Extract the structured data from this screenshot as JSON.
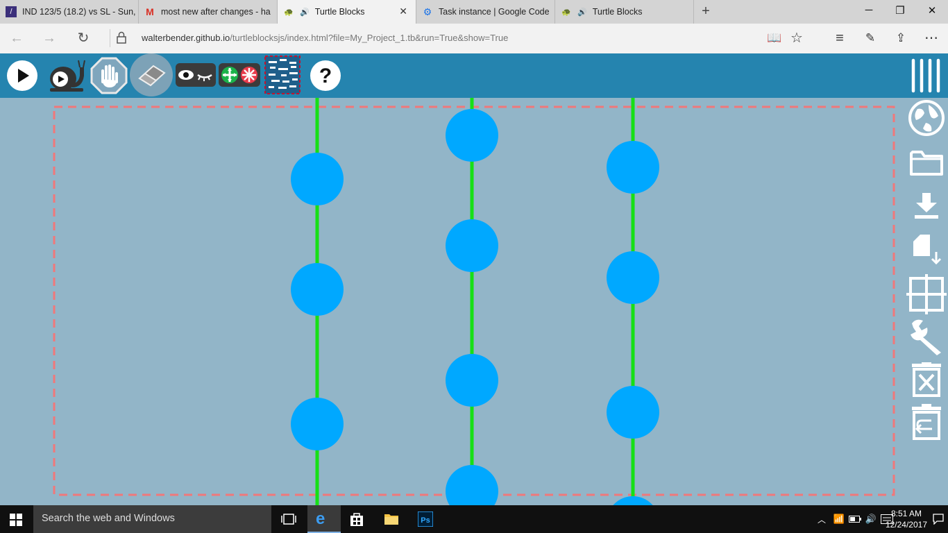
{
  "browser": {
    "tabs": [
      {
        "title": "IND 123/5 (18.2) vs SL - Sun,",
        "icon": "cricket-favicon",
        "active": false
      },
      {
        "title": "most new after changes - ha",
        "icon": "gmail-favicon",
        "active": false
      },
      {
        "title": "Turtle Blocks",
        "icon": "turtle-favicon",
        "audio": true,
        "active": true
      },
      {
        "title": "Task instance | Google Code",
        "icon": "google-code-favicon",
        "active": false
      },
      {
        "title": "Turtle Blocks",
        "icon": "turtle-favicon",
        "audio": true,
        "active": false
      }
    ],
    "new_tab": "+",
    "url_host": "walterbender.github.io",
    "url_path": "/turtleblocksjs/index.html?file=My_Project_1.tb&run=True&show=True"
  },
  "toolbar": {
    "left": [
      "play-icon",
      "slow-run-icon",
      "stop-icon",
      "clear-icon",
      "show-hide-blocks-icon",
      "collapse-expand-icon",
      "palette-grid-icon",
      "help-icon"
    ],
    "right": [
      "menu-icon"
    ]
  },
  "sidebar": [
    "globe-icon",
    "open-folder-icon",
    "save-download-icon",
    "save-file-icon",
    "grid-icon",
    "settings-wrench-icon",
    "delete-all-icon",
    "restore-trash-icon"
  ],
  "canvas": {
    "colors": {
      "background": "#92b5c8",
      "line": "#16e016",
      "dot": "#00a8ff",
      "border": "#f0787a"
    }
  },
  "taskbar": {
    "search_placeholder": "Search the web and Windows",
    "time": "8:51 AM",
    "date": "12/24/2017"
  }
}
